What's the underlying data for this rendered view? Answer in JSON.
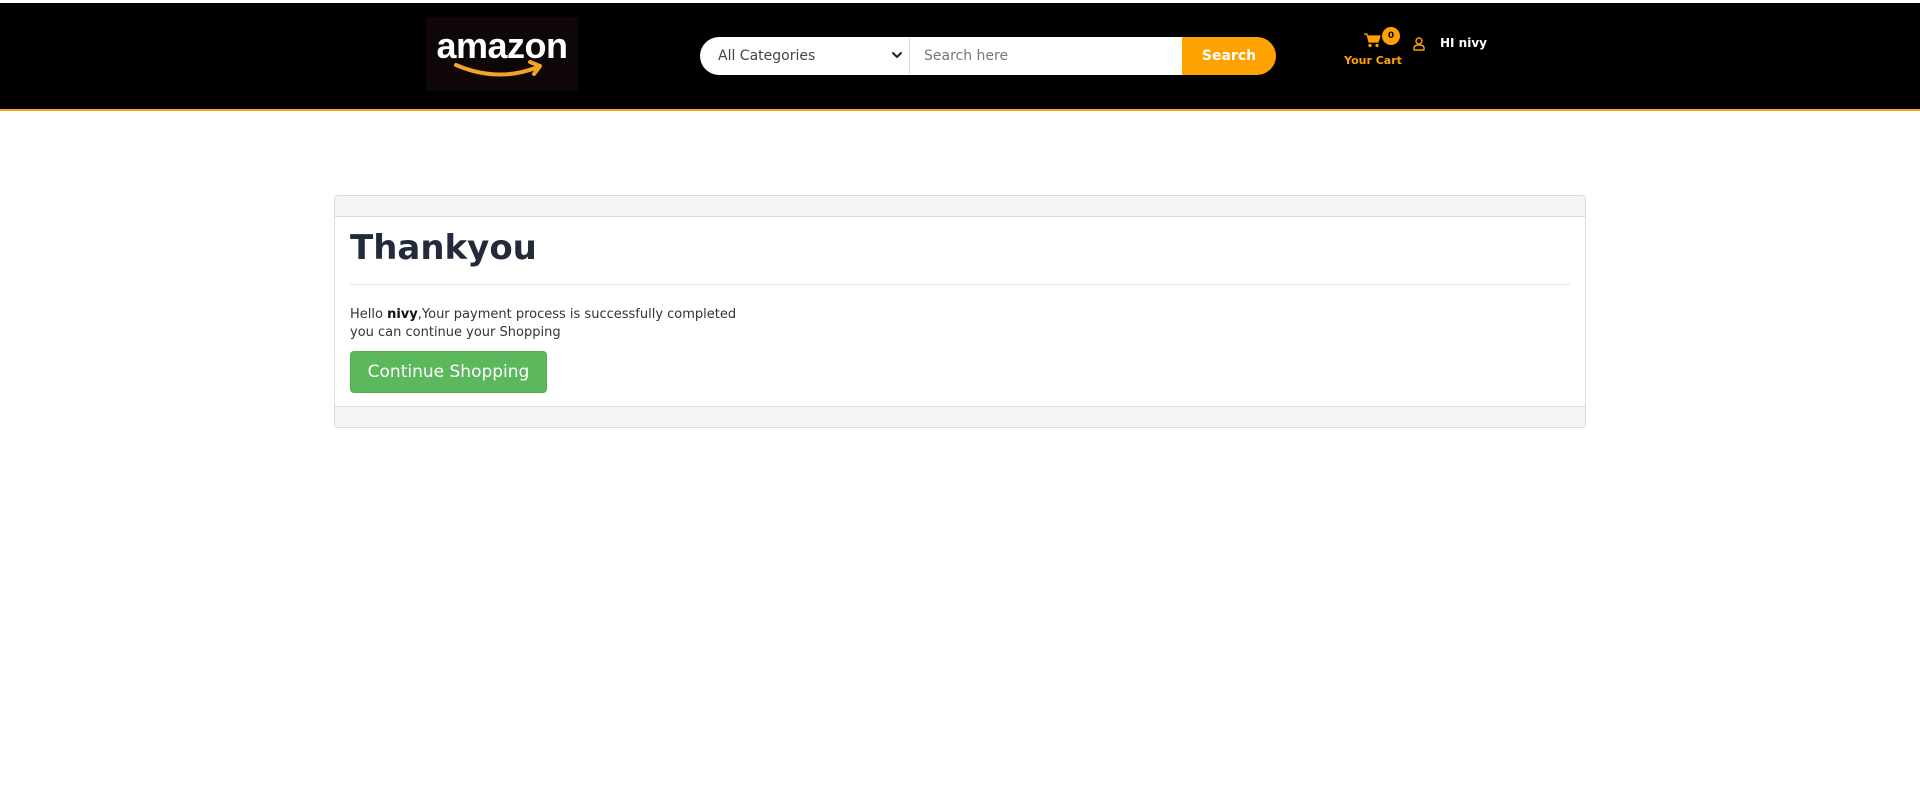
{
  "header": {
    "logo_text": "amazon",
    "category_select": {
      "selected": "All Categories"
    },
    "search": {
      "placeholder": "Search here",
      "value": "",
      "button_label": "Search"
    },
    "cart": {
      "label": "Your Cart",
      "count": "0"
    },
    "user": {
      "greeting": "HI nivy"
    }
  },
  "main": {
    "title": "Thankyou",
    "message": {
      "hello": "Hello",
      "username": "nivy",
      "line1_rest": ",Your payment process is successfully completed",
      "line2": "you can continue your Shopping"
    },
    "continue_button_label": "Continue Shopping"
  },
  "colors": {
    "header_bg": "#000000",
    "accent": "#ffa200",
    "success_button": "#5cb85c",
    "title_text": "#232a3a"
  },
  "icons": {
    "cart": "shopping-cart-icon",
    "user": "user-icon",
    "dropdown": "chevron-down-icon",
    "logo_arrow": "amazon-smile-arrow"
  }
}
